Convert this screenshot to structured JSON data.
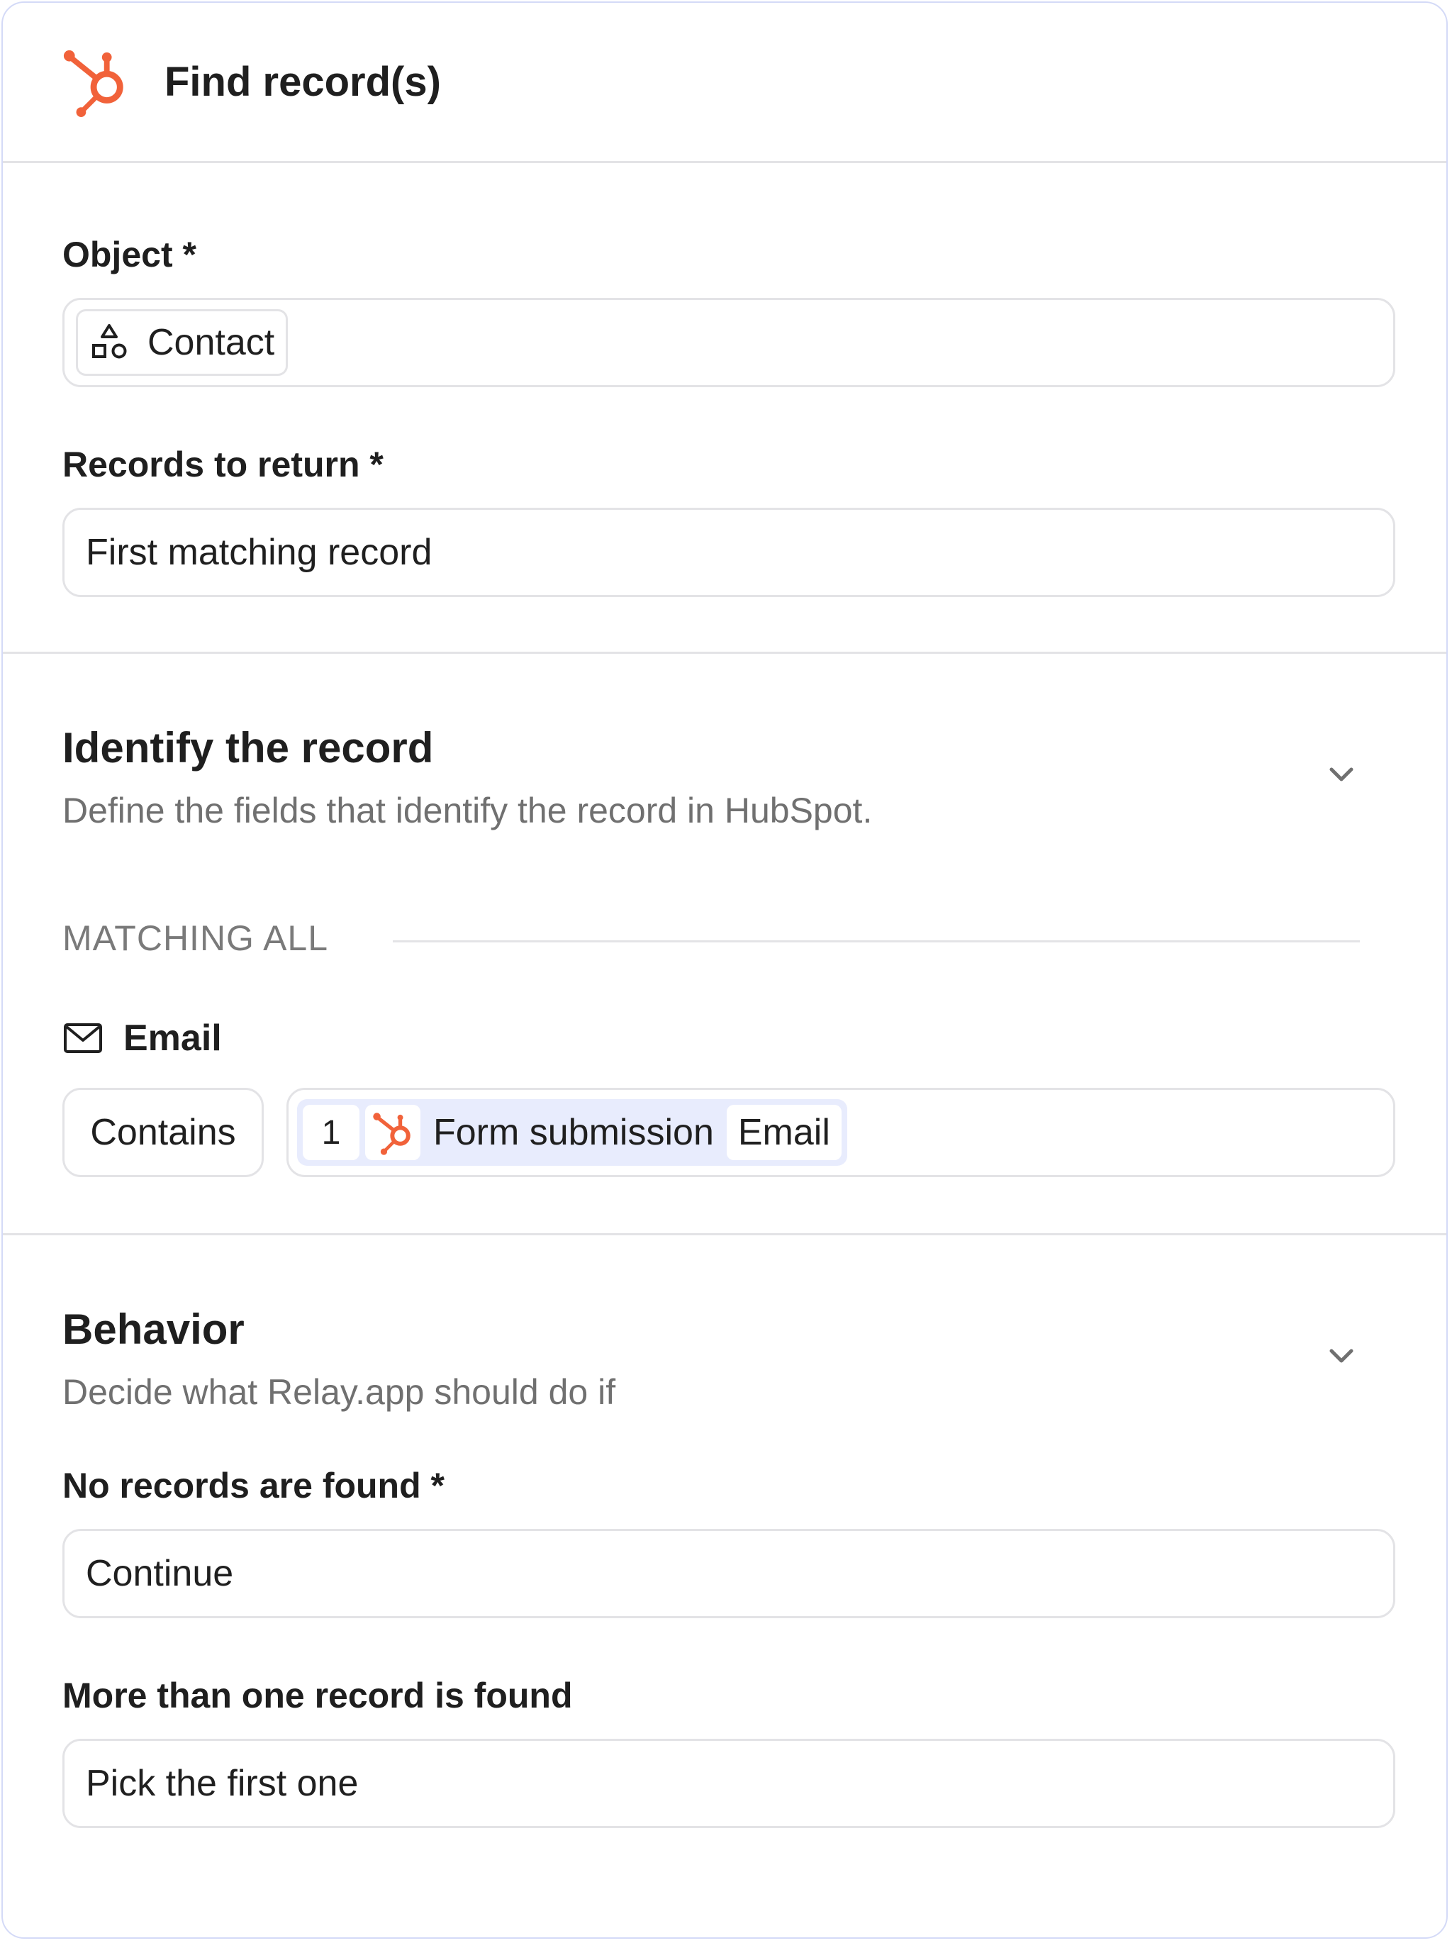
{
  "header": {
    "title": "Find record(s)",
    "icon": "hubspot-icon",
    "brand_color": "#f1623a"
  },
  "object": {
    "label": "Object *",
    "value": "Contact",
    "value_icon": "shapes-icon"
  },
  "records_to_return": {
    "label": "Records to return *",
    "value": "First matching record"
  },
  "identify": {
    "title": "Identify the record",
    "subtitle": "Define the fields that identify the record in HubSpot.",
    "matching_label": "MATCHING ALL",
    "field": {
      "label": "Email",
      "icon": "mail-icon",
      "operator": "Contains",
      "token": {
        "step": "1",
        "source": "Form submission",
        "field": "Email",
        "icon": "hubspot-icon"
      }
    }
  },
  "behavior": {
    "title": "Behavior",
    "subtitle": "Decide what Relay.app should do if",
    "no_records": {
      "label": "No records are found *",
      "value": "Continue"
    },
    "multiple": {
      "label": "More than one record is found",
      "value": "Pick the first one"
    }
  }
}
